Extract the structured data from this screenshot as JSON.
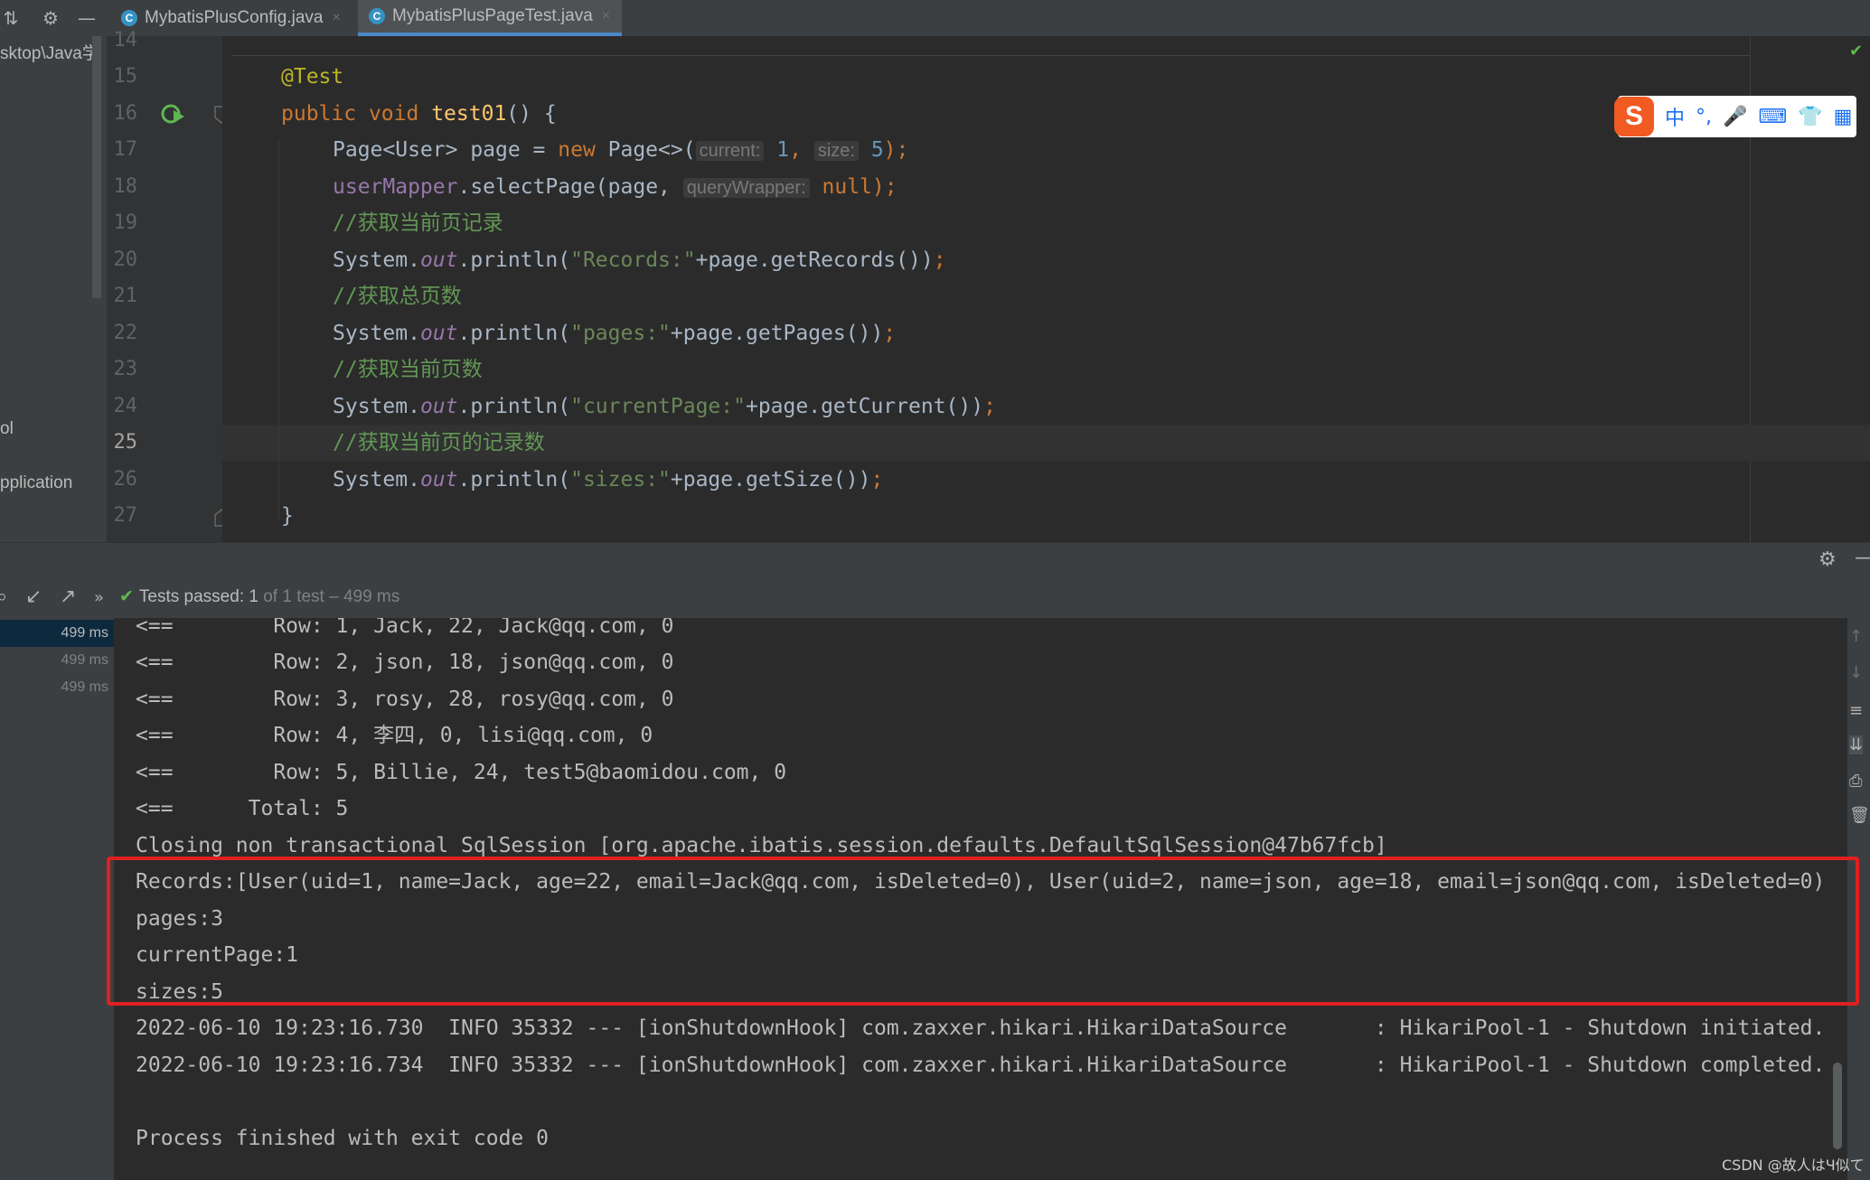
{
  "tabs": [
    {
      "label": "MybatisPlusConfig.java",
      "icon": "class-c-icon",
      "close": "×"
    },
    {
      "label": "MybatisPlusPageTest.java",
      "icon": "class-c-icon",
      "close": "×"
    }
  ],
  "left_panel": {
    "path_fragment": "sktop\\Java学",
    "item1": "ol",
    "item2": "pplication"
  },
  "editor": {
    "current_line": 25,
    "lines": [
      {
        "num": "14"
      },
      {
        "num": "15",
        "annotation": "@Test"
      },
      {
        "num": "16",
        "kw1": "public",
        "kw2": "void",
        "method": "test01",
        "rest": "() {"
      },
      {
        "num": "17",
        "type": "Page<User> page = ",
        "kw": "new",
        "ctor": " Page<>(",
        "hint1": "current:",
        "v1": "1",
        "sep": ",",
        "hint2": "size:",
        "v2": "5",
        "end": ");"
      },
      {
        "num": "18",
        "field": "userMapper",
        "call": ".selectPage(page, ",
        "hint": "queryWrapper:",
        "kw": "null",
        "end": ");"
      },
      {
        "num": "19",
        "comment": "//获取当前页记录"
      },
      {
        "num": "20",
        "sys": "System.",
        "out": "out",
        "call": ".println(",
        "str": "\"Records:\"",
        "rest": "+page.getRecords())",
        "semi": ";"
      },
      {
        "num": "21",
        "comment": "//获取总页数"
      },
      {
        "num": "22",
        "sys": "System.",
        "out": "out",
        "call": ".println(",
        "str": "\"pages:\"",
        "rest": "+page.getPages())",
        "semi": ";"
      },
      {
        "num": "23",
        "comment": "//获取当前页数"
      },
      {
        "num": "24",
        "sys": "System.",
        "out": "out",
        "call": ".println(",
        "str": "\"currentPage:\"",
        "rest": "+page.getCurrent())",
        "semi": ";"
      },
      {
        "num": "25",
        "comment": "//获取当前页的记录数"
      },
      {
        "num": "26",
        "sys": "System.",
        "out": "out",
        "call": ".println(",
        "str": "\"sizes:\"",
        "rest": "+page.getSize())",
        "semi": ";"
      },
      {
        "num": "27",
        "brace": "}"
      }
    ]
  },
  "ime": {
    "logo": "S",
    "lang": "中",
    "punct": "°,",
    "mic": "🎤",
    "kbd": "⌨",
    "skin": "👕",
    "grid": "▦"
  },
  "run": {
    "status_check": "✔",
    "status_main": "Tests passed: ",
    "status_count": "1",
    "status_rest": " of 1 test – 499 ms",
    "tree_times": [
      "499 ms",
      "499 ms",
      "499 ms"
    ]
  },
  "console": [
    "<==        Row: 1, Jack, 22, Jack@qq.com, 0",
    "<==        Row: 2, json, 18, json@qq.com, 0",
    "<==        Row: 3, rosy, 28, rosy@qq.com, 0",
    "<==        Row: 4, 李四, 0, lisi@qq.com, 0",
    "<==        Row: 5, Billie, 24, test5@baomidou.com, 0",
    "<==      Total: 5",
    "Closing non transactional SqlSession [org.apache.ibatis.session.defaults.DefaultSqlSession@47b67fcb]",
    "Records:[User(uid=1, name=Jack, age=22, email=Jack@qq.com, isDeleted=0), User(uid=2, name=json, age=18, email=json@qq.com, isDeleted=0)",
    "pages:3",
    "currentPage:1",
    "sizes:5",
    "2022-06-10 19:23:16.730  INFO 35332 --- [ionShutdownHook] com.zaxxer.hikari.HikariDataSource       : HikariPool-1 - Shutdown initiated.",
    "2022-06-10 19:23:16.734  INFO 35332 --- [ionShutdownHook] com.zaxxer.hikari.HikariDataSource       : HikariPool-1 - Shutdown completed.",
    "",
    "Process finished with exit code 0"
  ],
  "watermark": "CSDN @故人はЧ似て",
  "colors": {
    "highlight_box": "#e02020",
    "accent": "#4a88c7",
    "pass": "#5fb850"
  }
}
